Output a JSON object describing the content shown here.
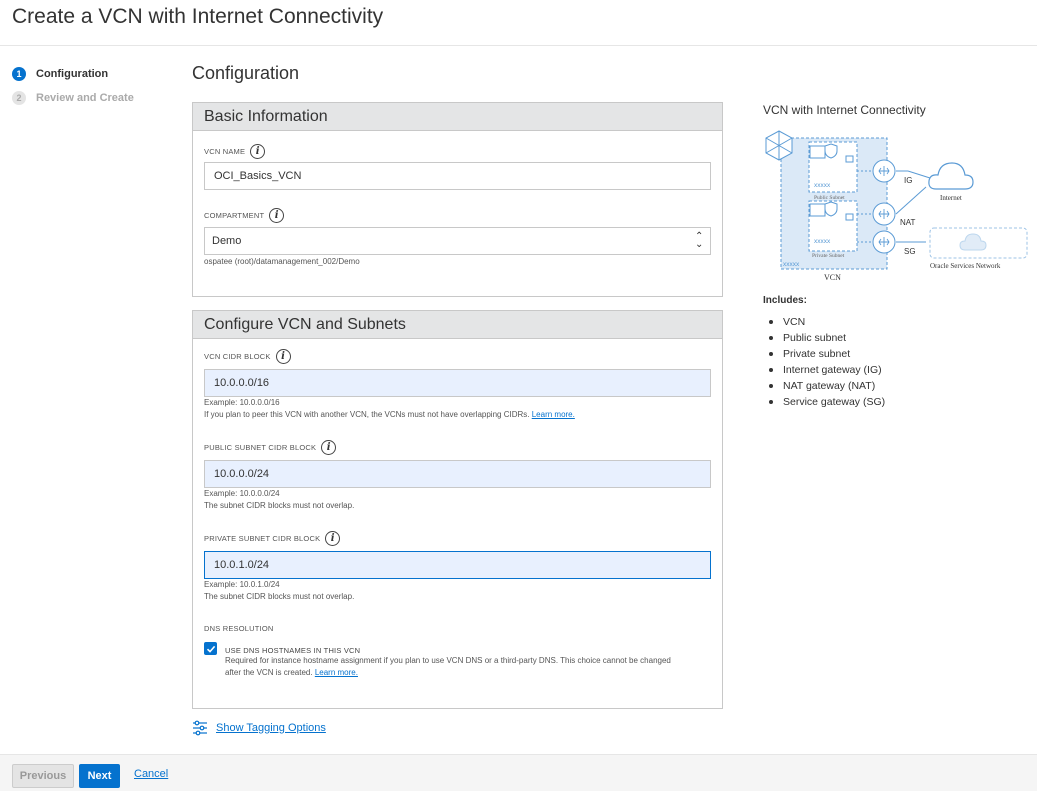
{
  "page": {
    "title": "Create a VCN with Internet Connectivity"
  },
  "steps": [
    {
      "number": "1",
      "label": "Configuration"
    },
    {
      "number": "2",
      "label": "Review and Create"
    }
  ],
  "section_title": "Configuration",
  "basic_info": {
    "heading": "Basic Information",
    "vcn_name_label": "VCN NAME",
    "vcn_name_value": "OCI_Basics_VCN",
    "compartment_label": "COMPARTMENT",
    "compartment_value": "Demo",
    "compartment_path": "ospatee (root)/datamanagement_002/Demo"
  },
  "configure": {
    "heading": "Configure VCN and Subnets",
    "vcn_cidr_label": "VCN CIDR BLOCK",
    "vcn_cidr_value": "10.0.0.0/16",
    "vcn_cidr_example": "Example: 10.0.0.0/16",
    "vcn_cidr_help": "If you plan to peer this VCN with another VCN, the VCNs must not have overlapping CIDRs.",
    "learn_more": "Learn more.",
    "public_label": "PUBLIC SUBNET CIDR BLOCK",
    "public_value": "10.0.0.0/24",
    "public_example": "Example: 10.0.0.0/24",
    "public_help": "The subnet CIDR blocks must not overlap.",
    "private_label": "PRIVATE SUBNET CIDR BLOCK",
    "private_value": "10.0.1.0/24",
    "private_example": "Example: 10.0.1.0/24",
    "private_help": "The subnet CIDR blocks must not overlap.",
    "dns_label": "DNS RESOLUTION",
    "dns_checkbox_label": "USE DNS HOSTNAMES IN THIS VCN",
    "dns_checked": true,
    "dns_help_1": "Required for instance hostname assignment if you plan to use VCN DNS or a third-party DNS. This choice cannot be changed",
    "dns_help_2": "after the VCN is created.",
    "dns_learn_more": "Learn more."
  },
  "tagging": {
    "label": "Show Tagging Options"
  },
  "footer": {
    "previous": "Previous",
    "next": "Next",
    "cancel": "Cancel"
  },
  "diagram": {
    "title": "VCN with Internet Connectivity",
    "public_subnet": "Public Subnet",
    "private_subnet": "Private Subnet",
    "subnet_id_placeholder": "xxxxx",
    "vcn_id_placeholder": "xxxxx",
    "vcn": "VCN",
    "ig": "IG",
    "nat": "NAT",
    "sg": "SG",
    "internet": "Internet",
    "oracle_services": "Oracle Services Network"
  },
  "includes": {
    "title": "Includes:",
    "items": [
      "VCN",
      "Public subnet",
      "Private subnet",
      "Internet gateway (IG)",
      "NAT gateway (NAT)",
      "Service gateway (SG)"
    ]
  },
  "colors": {
    "accent": "#0572ce",
    "panel_header": "#e4e5e6",
    "input_fill": "#e8f0fe",
    "diagram_blue": "#5b9bd5"
  }
}
